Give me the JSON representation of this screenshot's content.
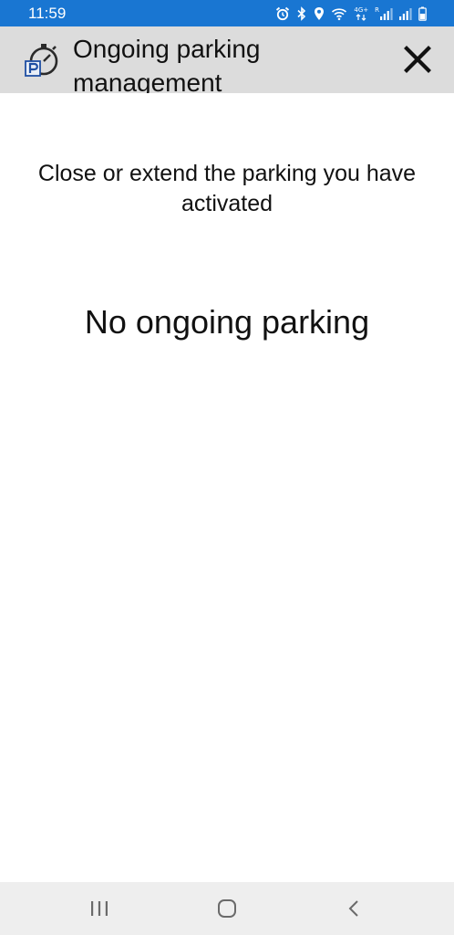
{
  "status_bar": {
    "time": "11:59",
    "network_label_top": "4G+",
    "network_label_mid": "R",
    "icons": [
      "alarm-icon",
      "bluetooth-icon",
      "location-icon",
      "wifi-icon",
      "mobile-data-icon",
      "signal-icon",
      "signal-icon",
      "battery-icon"
    ]
  },
  "header": {
    "title": "Ongoing parking management",
    "icon": "parking-timer-icon",
    "close_icon": "close-icon"
  },
  "main": {
    "subtitle": "Close or extend the parking you have activated",
    "empty_state": "No ongoing parking"
  },
  "nav_bar": {
    "buttons": [
      "recent-apps-icon",
      "home-icon",
      "back-icon"
    ]
  },
  "colors": {
    "status_bar": "#1976d2",
    "header_background": "#dcdcdc",
    "nav_bar_background": "#eeeeee",
    "text": "#111111"
  }
}
